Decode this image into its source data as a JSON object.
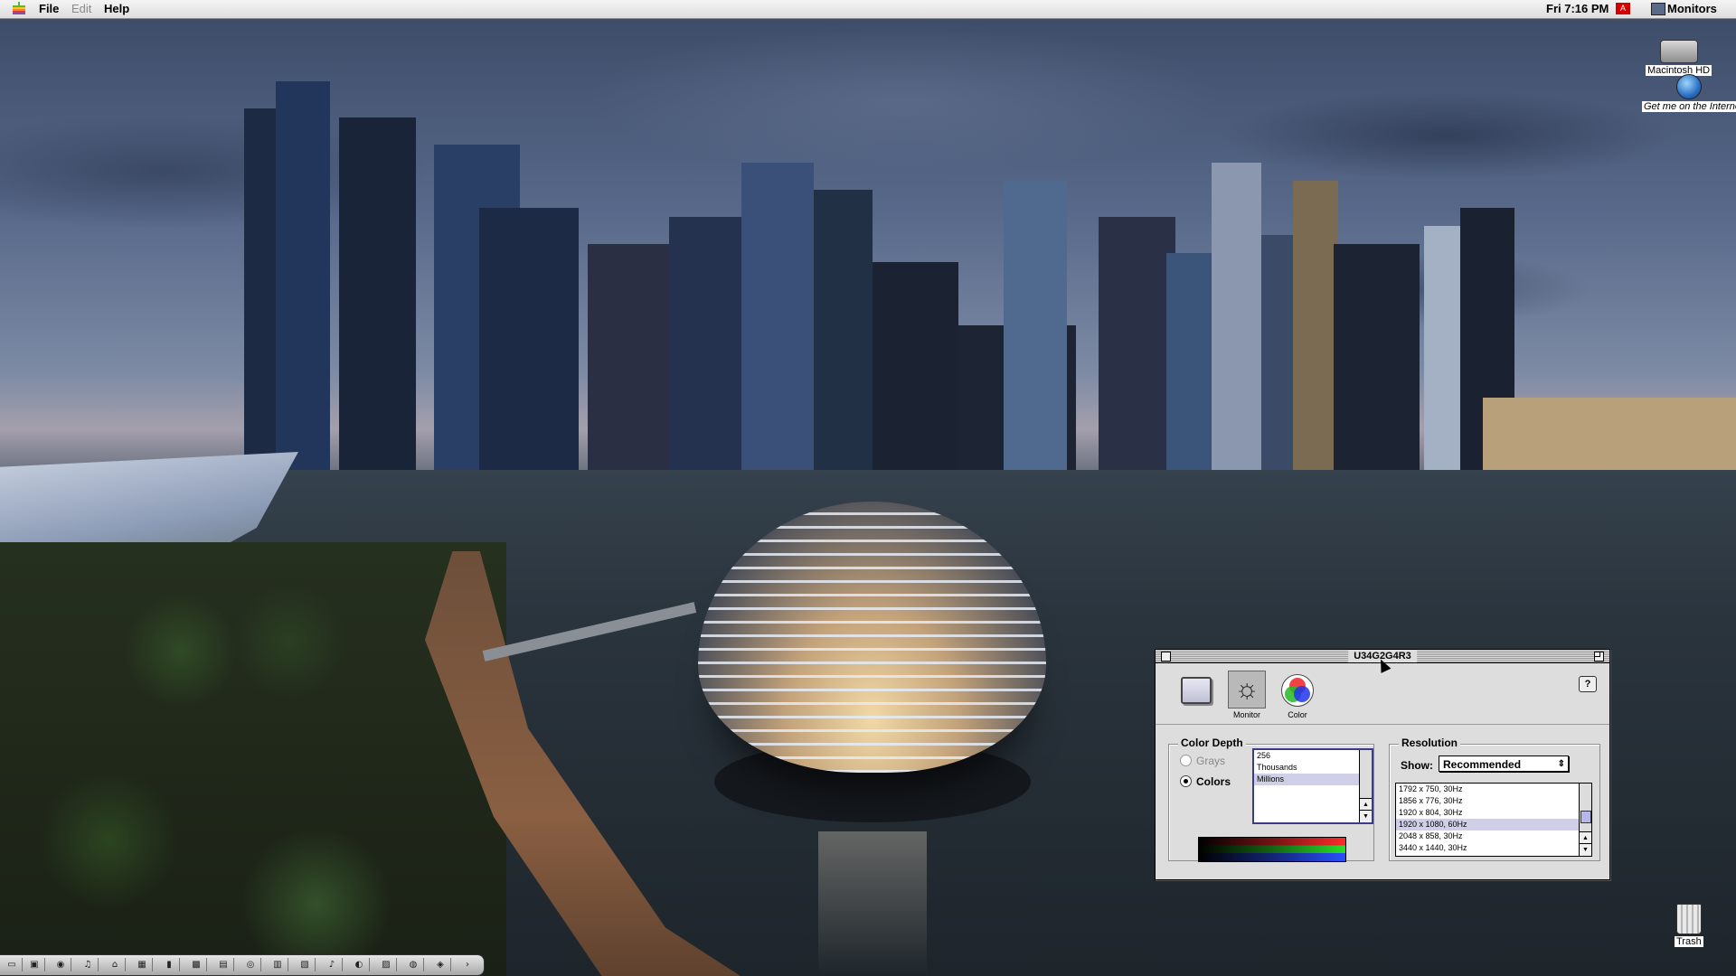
{
  "menubar": {
    "menus": [
      "File",
      "Edit",
      "Help"
    ],
    "clock": "Fri 7:16 PM",
    "app_name": "Monitors"
  },
  "desktop": {
    "icons": [
      {
        "label": "Macintosh HD",
        "icon": "hard-disk-icon"
      },
      {
        "label": "Get me on the Internet",
        "icon": "globe-icon"
      },
      {
        "label": "Trash",
        "icon": "trash-icon"
      }
    ]
  },
  "window": {
    "title": "U34G2G4R3",
    "toolbar": [
      {
        "label": "",
        "icon": "monitor-icon",
        "selected": false
      },
      {
        "label": "Monitor",
        "icon": "brightness-icon",
        "selected": true
      },
      {
        "label": "Color",
        "icon": "color-wheel-icon",
        "selected": false
      }
    ],
    "help_label": "?",
    "color_depth": {
      "title": "Color Depth",
      "grays_label": "Grays",
      "colors_label": "Colors",
      "selected_mode": "Colors",
      "options": [
        "256",
        "Thousands",
        "Millions"
      ],
      "selected_option": "Millions"
    },
    "resolution": {
      "title": "Resolution",
      "show_label": "Show:",
      "show_value": "Recommended",
      "options": [
        "1792 x 750, 30Hz",
        "1856 x 776, 30Hz",
        "1920 x 804, 30Hz",
        "1920 x 1080, 60Hz",
        "2048 x 858, 30Hz",
        "3440 x 1440, 30Hz"
      ],
      "selected_option": "1920 x 1080, 60Hz"
    }
  },
  "control_strip": {
    "module_count": 18
  }
}
